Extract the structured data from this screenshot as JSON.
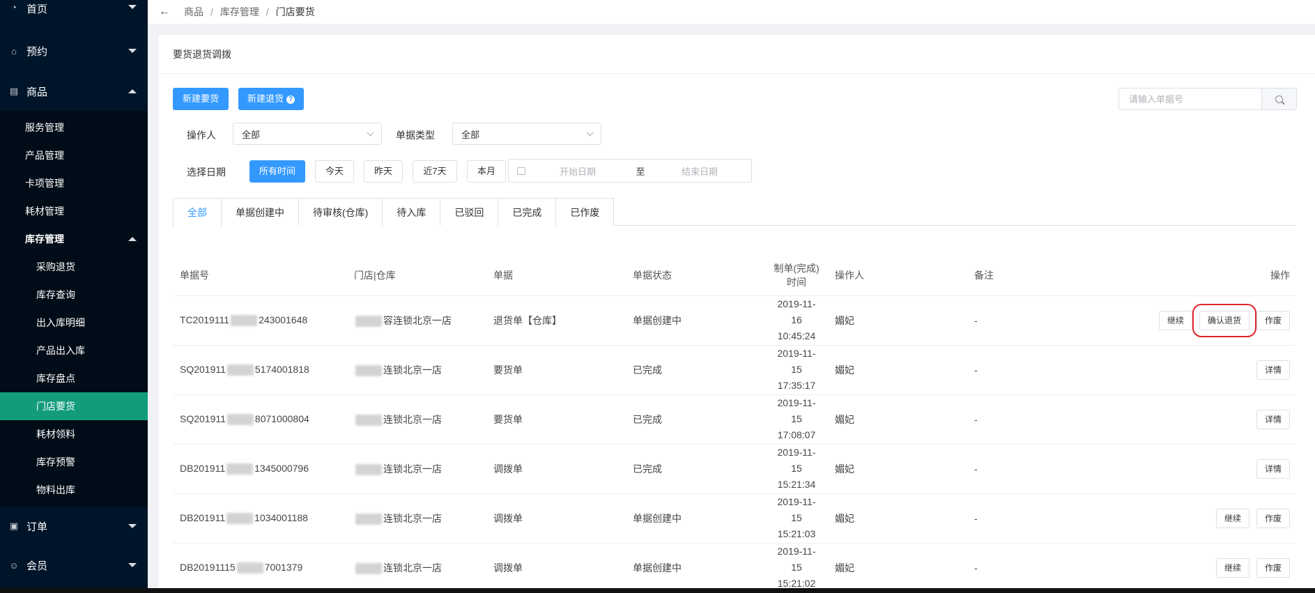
{
  "sidebar": {
    "home": "首页",
    "booking": "预约",
    "goods": "商品",
    "goods_items": [
      "服务管理",
      "产品管理",
      "卡项管理",
      "耗材管理"
    ],
    "stock_group": "库存管理",
    "stock_items": [
      "采购退货",
      "库存查询",
      "出入库明细",
      "产品出入库",
      "库存盘点",
      "门店要货",
      "耗材领料",
      "库存预警",
      "物料出库"
    ],
    "orders": "订单",
    "members": "会员"
  },
  "breadcrumb": [
    "商品",
    "库存管理",
    "门店要货"
  ],
  "card_title": "要货退货调拨",
  "toolbar": {
    "new_request": "新建要货",
    "new_return": "新建退货",
    "search_placeholder": "请输入单据号"
  },
  "filters": {
    "operator_label": "操作人",
    "operator_value": "全部",
    "doc_type_label": "单据类型",
    "doc_type_value": "全部",
    "date_label": "选择日期",
    "date_options": [
      "所有时间",
      "今天",
      "昨天",
      "近7天",
      "本月"
    ],
    "start_placeholder": "开始日期",
    "range_sep": "至",
    "end_placeholder": "结束日期"
  },
  "tabs": [
    "全部",
    "单据创建中",
    "待审核(仓库)",
    "待入库",
    "已驳回",
    "已完成",
    "已作废"
  ],
  "table": {
    "headers": [
      "单据号",
      "门店|仓库",
      "单据",
      "单据状态",
      "制单(完成)时间",
      "操作人",
      "备注",
      "操作"
    ],
    "rows": [
      {
        "no_pre": "TC2019111",
        "no_suf": "243001648",
        "store_pre": "",
        "store_suf": "容连锁北京一店",
        "doc": "退货单【仓库】",
        "status": "单据创建中",
        "date": "2019-11-16",
        "time": "10:45:24",
        "operator": "媚妃",
        "remark": "-",
        "actions": [
          "继续",
          "确认退货",
          "作废"
        ]
      },
      {
        "no_pre": "SQ201911",
        "no_suf": "5174001818",
        "store_pre": "",
        "store_suf": "连锁北京一店",
        "doc": "要货单",
        "status": "已完成",
        "date": "2019-11-15",
        "time": "17:35:17",
        "operator": "媚妃",
        "remark": "-",
        "actions": [
          "详情"
        ]
      },
      {
        "no_pre": "SQ201911",
        "no_suf": "8071000804",
        "store_pre": "",
        "store_suf": "连锁北京一店",
        "doc": "要货单",
        "status": "已完成",
        "date": "2019-11-15",
        "time": "17:08:07",
        "operator": "媚妃",
        "remark": "-",
        "actions": [
          "详情"
        ]
      },
      {
        "no_pre": "DB201911",
        "no_suf": "1345000796",
        "store_pre": "",
        "store_suf": "连锁北京一店",
        "doc": "调拨单",
        "status": "已完成",
        "date": "2019-11-15",
        "time": "15:21:34",
        "operator": "媚妃",
        "remark": "-",
        "actions": [
          "详情"
        ]
      },
      {
        "no_pre": "DB201911",
        "no_suf": "1034001188",
        "store_pre": "",
        "store_suf": "连锁北京一店",
        "doc": "调拨单",
        "status": "单据创建中",
        "date": "2019-11-15",
        "time": "15:21:03",
        "operator": "媚妃",
        "remark": "-",
        "actions": [
          "继续",
          "作废"
        ]
      },
      {
        "no_pre": "DB20191115",
        "no_suf": "7001379",
        "store_pre": "",
        "store_suf": "连锁北京一店",
        "doc": "调拨单",
        "status": "单据创建中",
        "date": "2019-11-15",
        "time": "15:21:02",
        "operator": "媚妃",
        "remark": "-",
        "actions": [
          "继续",
          "作废"
        ]
      }
    ]
  }
}
